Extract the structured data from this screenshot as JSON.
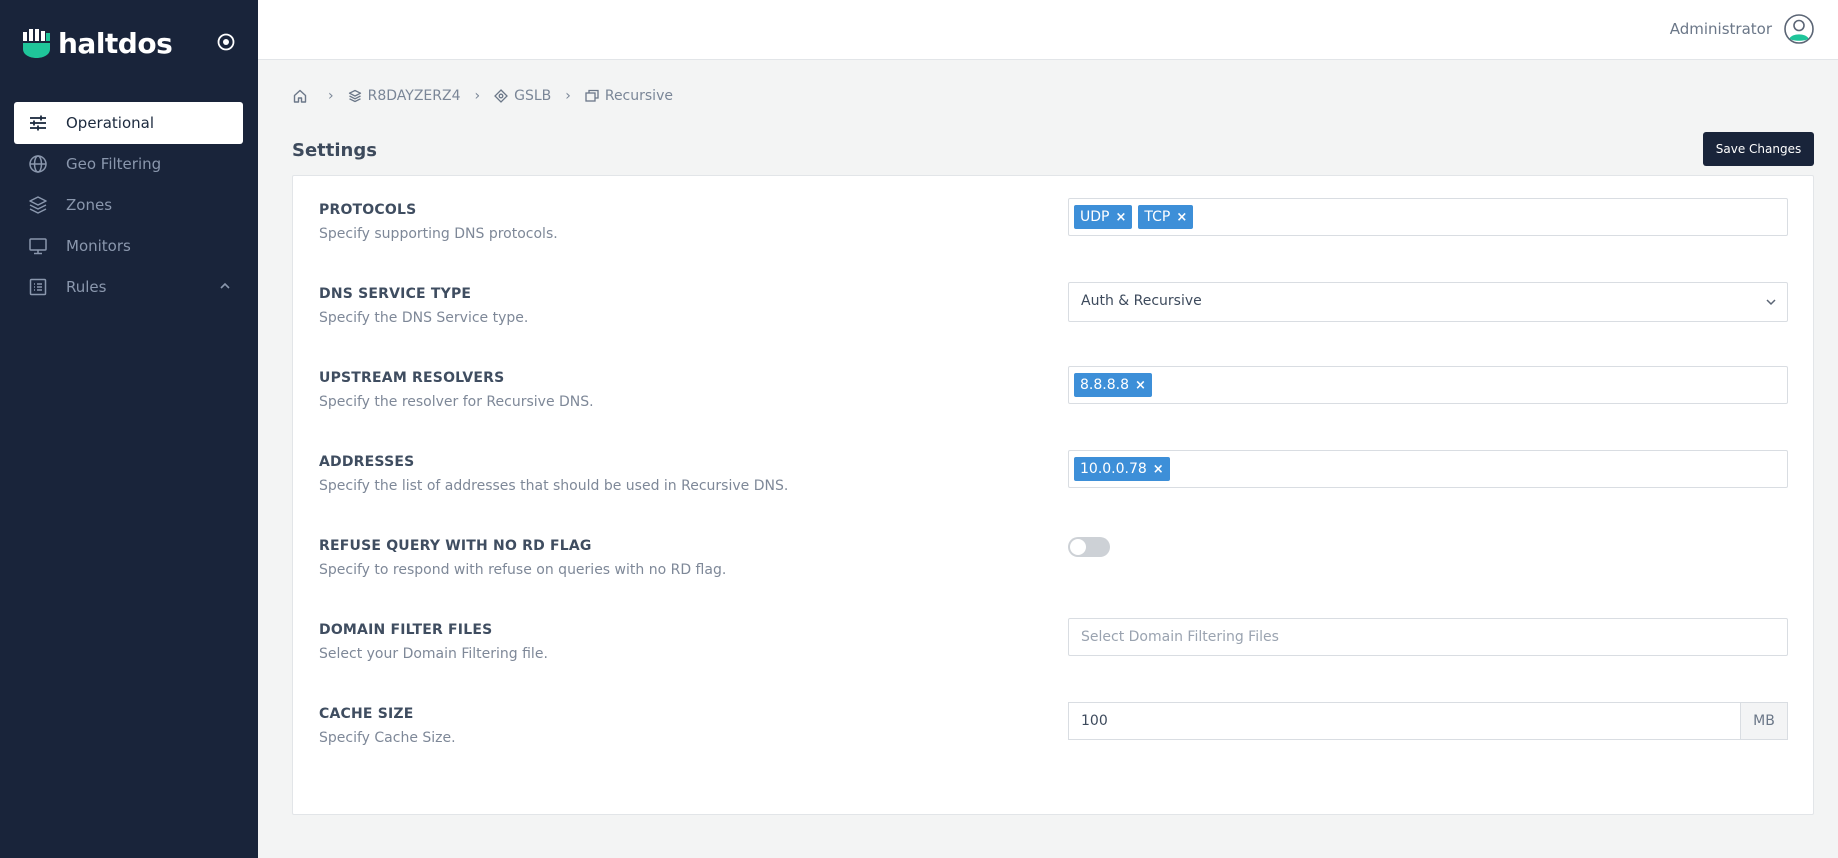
{
  "brand": {
    "name": "haltdos"
  },
  "sidebar": {
    "items": [
      {
        "label": "Operational",
        "icon": "sliders-icon",
        "active": true
      },
      {
        "label": "Geo Filtering",
        "icon": "globe-icon",
        "active": false
      },
      {
        "label": "Zones",
        "icon": "layers-icon",
        "active": false
      },
      {
        "label": "Monitors",
        "icon": "monitor-icon",
        "active": false
      },
      {
        "label": "Rules",
        "icon": "list-icon",
        "active": false,
        "expandable": true
      }
    ]
  },
  "header": {
    "user_name": "Administrator"
  },
  "breadcrumb": {
    "home_icon": "home-icon",
    "items": [
      {
        "label": "R8DAYZERZ4",
        "icon": "layers-icon"
      },
      {
        "label": "GSLB",
        "icon": "target-icon"
      },
      {
        "label": "Recursive",
        "icon": "windows-icon"
      }
    ],
    "separator": "›"
  },
  "page": {
    "title": "Settings",
    "save_label": "Save Changes"
  },
  "settings": {
    "protocols": {
      "label": "PROTOCOLS",
      "description": "Specify supporting DNS protocols.",
      "tags": [
        "UDP",
        "TCP"
      ]
    },
    "service_type": {
      "label": "DNS SERVICE TYPE",
      "description": "Specify the DNS Service type.",
      "value": "Auth & Recursive"
    },
    "upstream": {
      "label": "UPSTREAM RESOLVERS",
      "description": "Specify the resolver for Recursive DNS.",
      "tags": [
        "8.8.8.8"
      ]
    },
    "addresses": {
      "label": "ADDRESSES",
      "description": "Specify the list of addresses that should be used in Recursive DNS.",
      "tags": [
        "10.0.0.78"
      ]
    },
    "refuse_rd": {
      "label": "REFUSE QUERY WITH NO RD FLAG",
      "description": "Specify to respond with refuse on queries with no RD flag.",
      "enabled": false
    },
    "domain_filter": {
      "label": "DOMAIN FILTER FILES",
      "description": "Select your Domain Filtering file.",
      "placeholder": "Select Domain Filtering Files"
    },
    "cache_size": {
      "label": "CACHE SIZE",
      "description": "Specify Cache Size.",
      "value": "100",
      "unit": "MB"
    }
  },
  "colors": {
    "sidebar_bg": "#19243a",
    "accent_tag": "#3d8fd8",
    "logo_green": "#1fc59a"
  },
  "tag_remove": "×"
}
